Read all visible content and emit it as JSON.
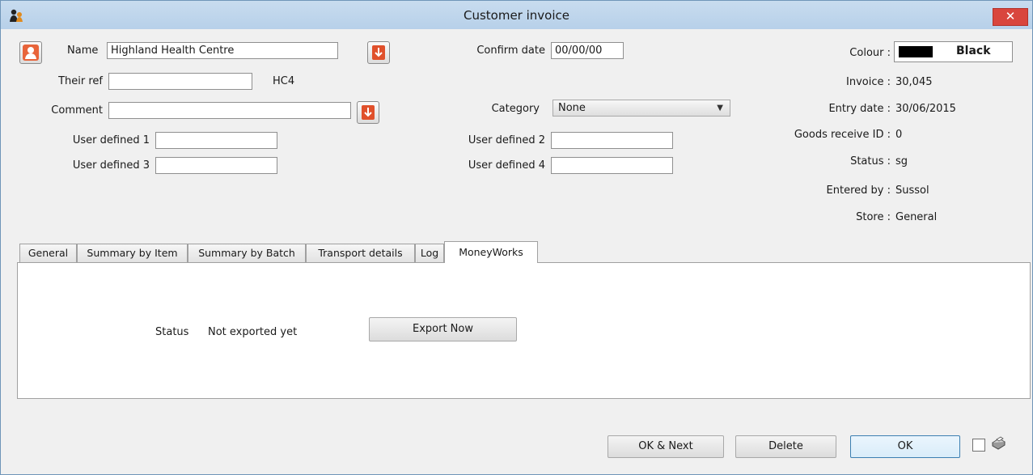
{
  "window": {
    "title": "Customer invoice",
    "close": "✕"
  },
  "colors": {
    "accent": "#d9463d",
    "arrow_button": "#e0502b",
    "swatch": "#000000"
  },
  "header": {
    "name_label": "Name",
    "name_value": "Highland Health Centre",
    "their_ref_label": "Their ref",
    "their_ref_value": "",
    "their_ref_code": "HC4",
    "comment_label": "Comment",
    "comment_value": "",
    "user_defined_1_label": "User defined 1",
    "user_defined_1_value": "",
    "user_defined_3_label": "User defined 3",
    "user_defined_3_value": "",
    "confirm_date_label": "Confirm date",
    "confirm_date_value": "00/00/00",
    "category_label": "Category",
    "category_value": "None",
    "user_defined_2_label": "User defined 2",
    "user_defined_2_value": "",
    "user_defined_4_label": "User defined 4",
    "user_defined_4_value": ""
  },
  "info": {
    "colour_label": "Colour :",
    "colour_value": "Black",
    "invoice_label": "Invoice :",
    "invoice_value": "30,045",
    "entry_date_label": "Entry date :",
    "entry_date_value": "30/06/2015",
    "goods_receive_label": "Goods receive ID :",
    "goods_receive_value": "0",
    "status_label": "Status :",
    "status_value": "sg",
    "entered_by_label": "Entered by :",
    "entered_by_value": "Sussol",
    "store_label": "Store :",
    "store_value": "General"
  },
  "tabs": [
    "General",
    "Summary by Item",
    "Summary by Batch",
    "Transport details",
    "Log",
    "MoneyWorks"
  ],
  "panel": {
    "status_label": "Status",
    "status_value": "Not exported yet",
    "export_button": "Export Now"
  },
  "footer": {
    "ok_next": "OK & Next",
    "delete": "Delete",
    "ok": "OK"
  }
}
